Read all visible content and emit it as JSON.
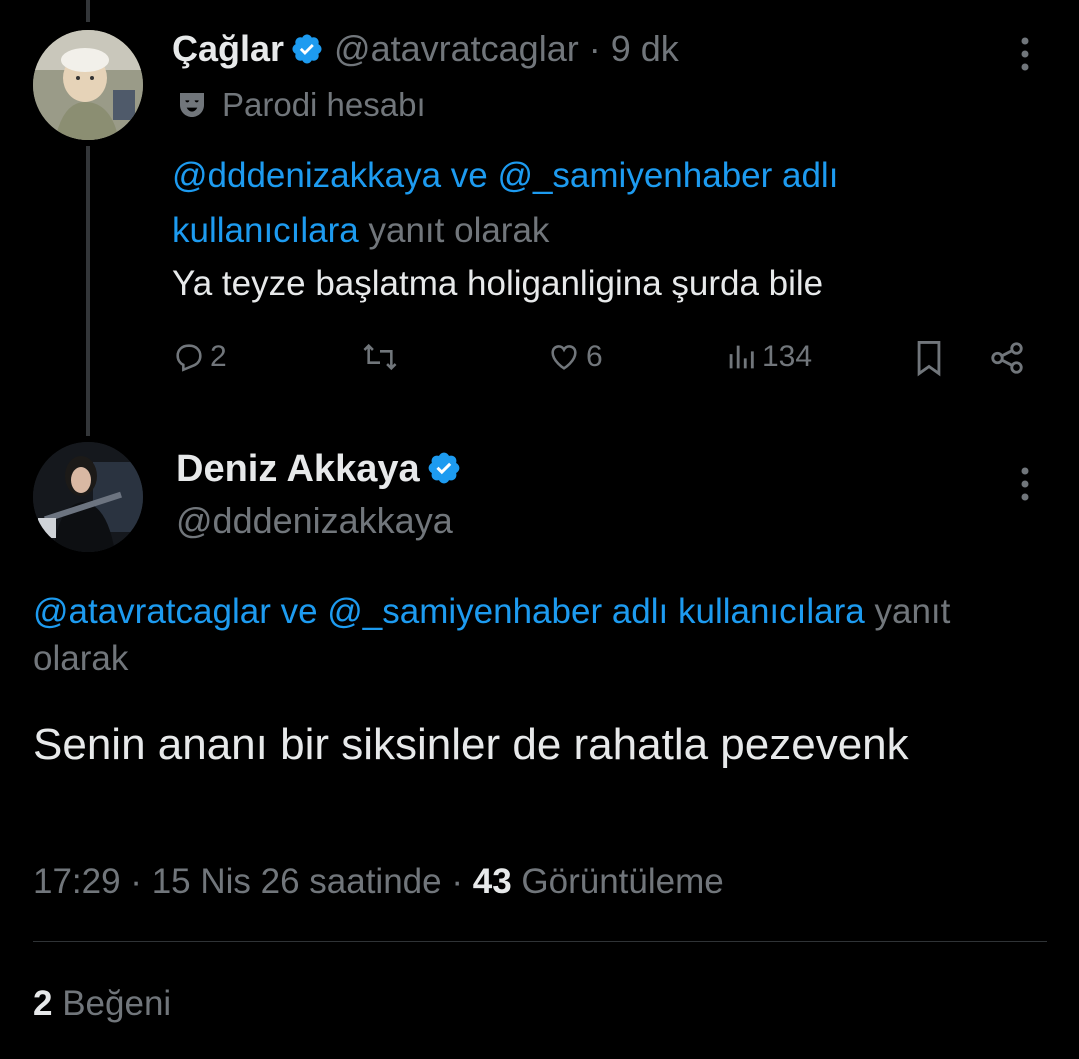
{
  "tweet1": {
    "name": "Çağlar",
    "handle": "@atavratcaglar",
    "separator": "·",
    "time": "9 dk",
    "parody_label": "Parodi hesabı",
    "reply_mentions": "@dddenizakkaya ve @_samiyenhaber adlı kullanıcılara",
    "reply_suffix": "yanıt olarak",
    "text": "Ya teyze başlatma holiganligina şurda bile",
    "replies": "2",
    "reposts": "",
    "likes": "6",
    "views": "134"
  },
  "tweet2": {
    "name": "Deniz Akkaya",
    "handle": "@dddenizakkaya",
    "reply_mentions": "@atavratcaglar ve @_samiyenhaber adlı kullanıcılara",
    "reply_suffix_1": "yanıt",
    "reply_suffix_2": "olarak",
    "text": "Senin ananı bir siksinler de rahatla pezevenk",
    "timestamp": "17:29 · 15 Nis 26 saatinde",
    "separator": "·",
    "view_count": "43",
    "view_label": "Görüntüleme",
    "like_count": "2",
    "like_label": "Beğeni"
  },
  "colors": {
    "background": "#000000",
    "text": "#e7e9ea",
    "muted": "#71767b",
    "link": "#1d9bf0",
    "verified": "#1d9bf0"
  }
}
